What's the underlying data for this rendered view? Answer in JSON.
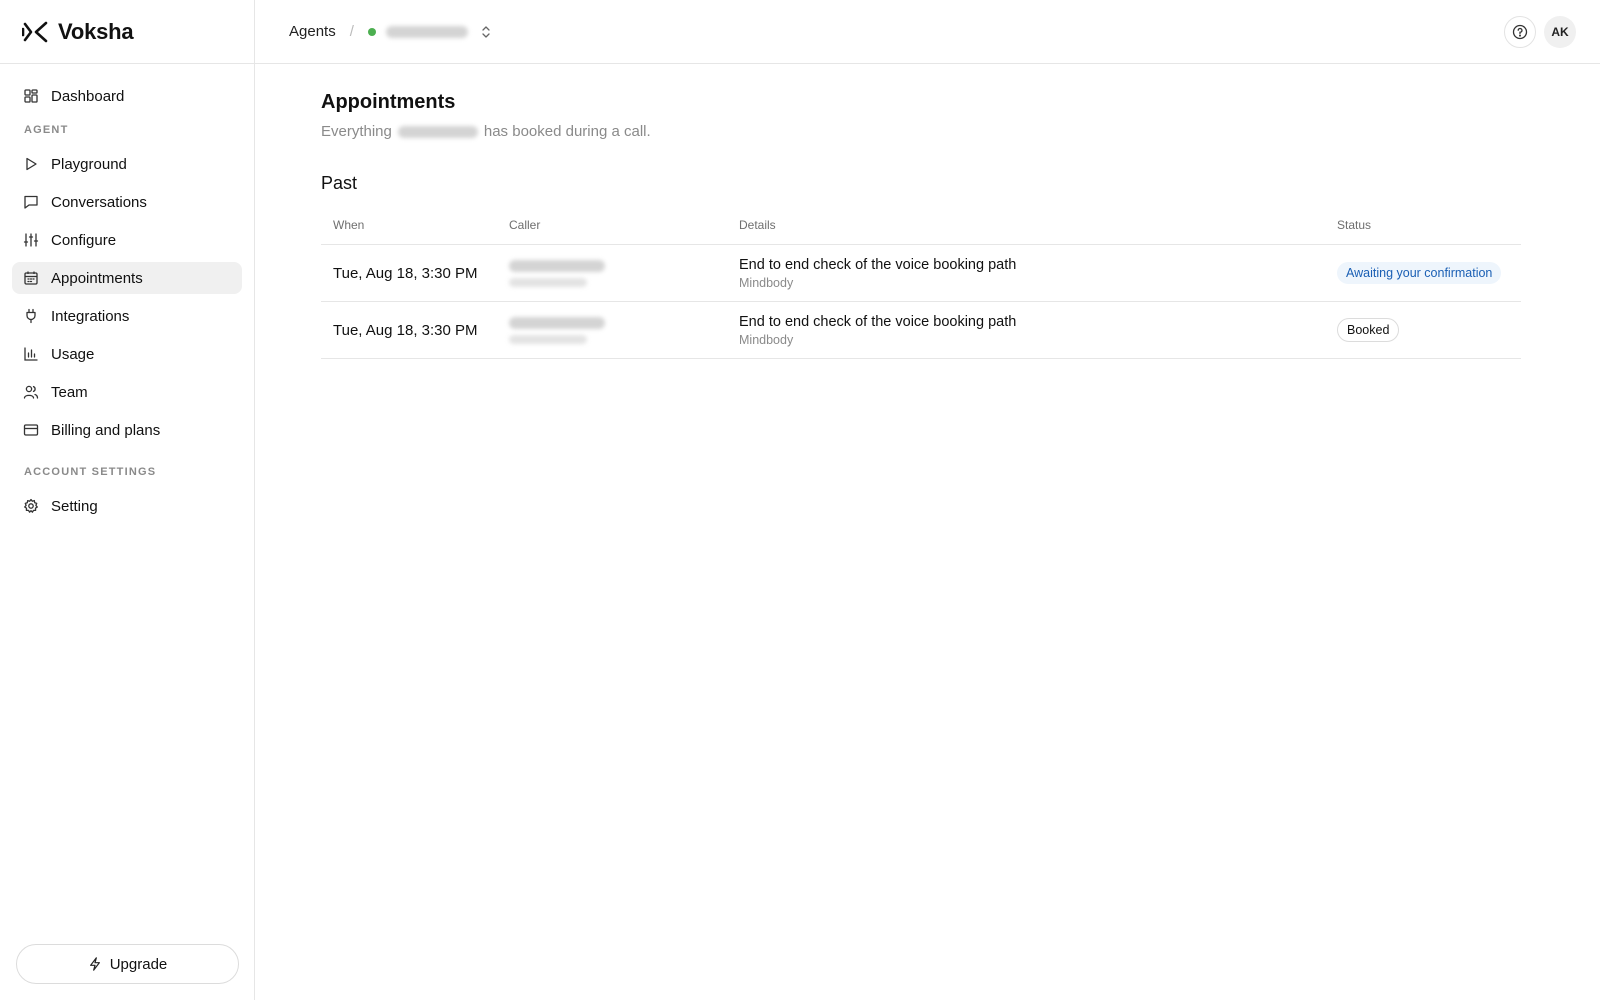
{
  "app": {
    "name": "Voksha"
  },
  "sidebar": {
    "dashboard": {
      "label": "Dashboard",
      "icon": "dashboard-icon"
    },
    "section_agent": "AGENT",
    "items": [
      {
        "label": "Playground",
        "icon": "play-icon"
      },
      {
        "label": "Conversations",
        "icon": "message-icon"
      },
      {
        "label": "Configure",
        "icon": "sliders-icon"
      },
      {
        "label": "Appointments",
        "icon": "calendar-icon",
        "active": true
      },
      {
        "label": "Integrations",
        "icon": "plug-icon"
      },
      {
        "label": "Usage",
        "icon": "bar-chart-icon"
      },
      {
        "label": "Team",
        "icon": "users-icon"
      },
      {
        "label": "Billing and plans",
        "icon": "credit-card-icon"
      }
    ],
    "section_account": "ACCOUNT SETTINGS",
    "setting": {
      "label": "Setting",
      "icon": "gear-icon"
    },
    "upgrade_label": "Upgrade"
  },
  "topbar": {
    "breadcrumb_root": "Agents",
    "separator": "/",
    "agent_status_color": "#4caf50",
    "avatar_initials": "AK"
  },
  "main": {
    "title": "Appointments",
    "subtitle_prefix": "Everything",
    "subtitle_suffix": "has booked during a call.",
    "section_title": "Past",
    "columns": [
      "When",
      "Caller",
      "Details",
      "Status"
    ],
    "rows": [
      {
        "when": "Tue, Aug 18, 3:30 PM",
        "detail_title": "End to end check of the voice booking path",
        "detail_sub": "Mindbody",
        "status": "Awaiting your confirmation",
        "status_kind": "awaiting"
      },
      {
        "when": "Tue, Aug 18, 3:30 PM",
        "detail_title": "End to end check of the voice booking path",
        "detail_sub": "Mindbody",
        "status": "Booked",
        "status_kind": "booked"
      }
    ]
  },
  "colors": {
    "status_awaiting_text": "#1a5fb4",
    "status_awaiting_bg": "#eef5fc",
    "active_nav_bg": "#f0f0f0"
  }
}
